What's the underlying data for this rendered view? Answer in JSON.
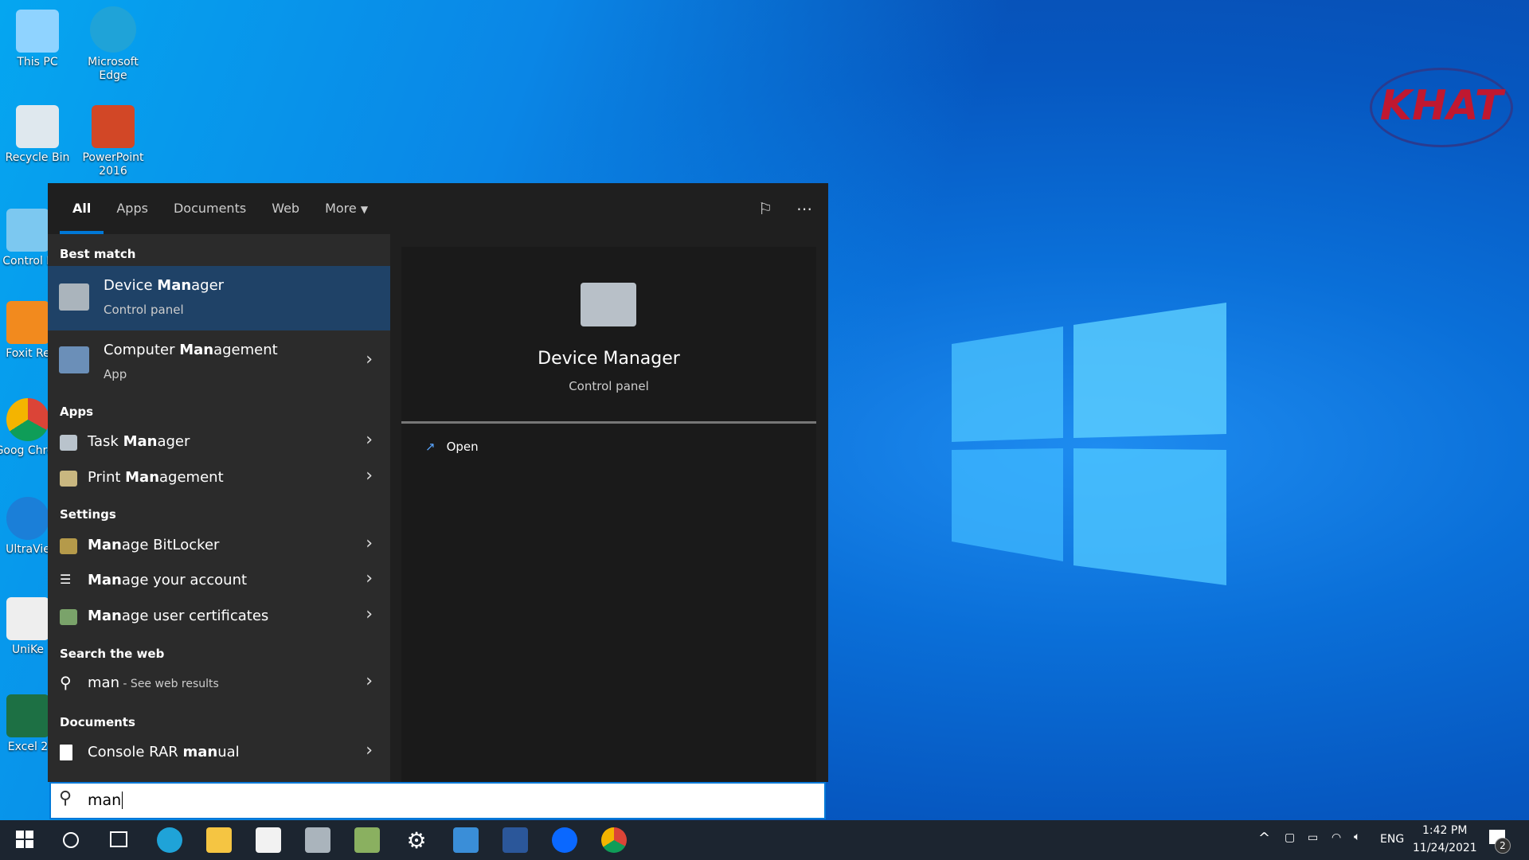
{
  "desktop": {
    "icons": [
      {
        "label": "This PC"
      },
      {
        "label": "Microsoft Edge"
      },
      {
        "label": "Recycle Bin"
      },
      {
        "label": "PowerPoint 2016"
      },
      {
        "label": "Control P"
      },
      {
        "label": "Foxit Re"
      },
      {
        "label": "Goog Chron"
      },
      {
        "label": "UltraVie"
      },
      {
        "label": "UniKe"
      },
      {
        "label": "Excel 2"
      }
    ],
    "brand_logo": "KHAT LAPTOP"
  },
  "menu": {
    "tabs": [
      "All",
      "Apps",
      "Documents",
      "Web",
      "More"
    ],
    "best_match_header": "Best match",
    "best": [
      {
        "pre": "Device ",
        "hl": "Man",
        "post": "ager",
        "sub": "Control panel"
      },
      {
        "pre": "Computer ",
        "hl": "Man",
        "post": "agement",
        "sub": "App"
      }
    ],
    "apps_header": "Apps",
    "apps": [
      {
        "pre": "Task ",
        "hl": "Man",
        "post": "ager"
      },
      {
        "pre": "Print ",
        "hl": "Man",
        "post": "agement"
      }
    ],
    "settings_header": "Settings",
    "settings": [
      {
        "pre": "",
        "hl": "Man",
        "post": "age BitLocker"
      },
      {
        "pre": "",
        "hl": "Man",
        "post": "age your account"
      },
      {
        "pre": "",
        "hl": "Man",
        "post": "age user certificates"
      }
    ],
    "web_header": "Search the web",
    "web": {
      "query": "man",
      "suffix": " - See web results"
    },
    "docs_header": "Documents",
    "docs": [
      {
        "pre": "Console RAR ",
        "hl": "man",
        "post": "ual"
      }
    ],
    "preview": {
      "title": "Device Manager",
      "subtitle": "Control panel",
      "open": "Open"
    },
    "search_value": "man"
  },
  "taskbar": {
    "time": "1:42 PM",
    "date": "11/24/2021",
    "lang": "ENG",
    "notifications": "2"
  }
}
